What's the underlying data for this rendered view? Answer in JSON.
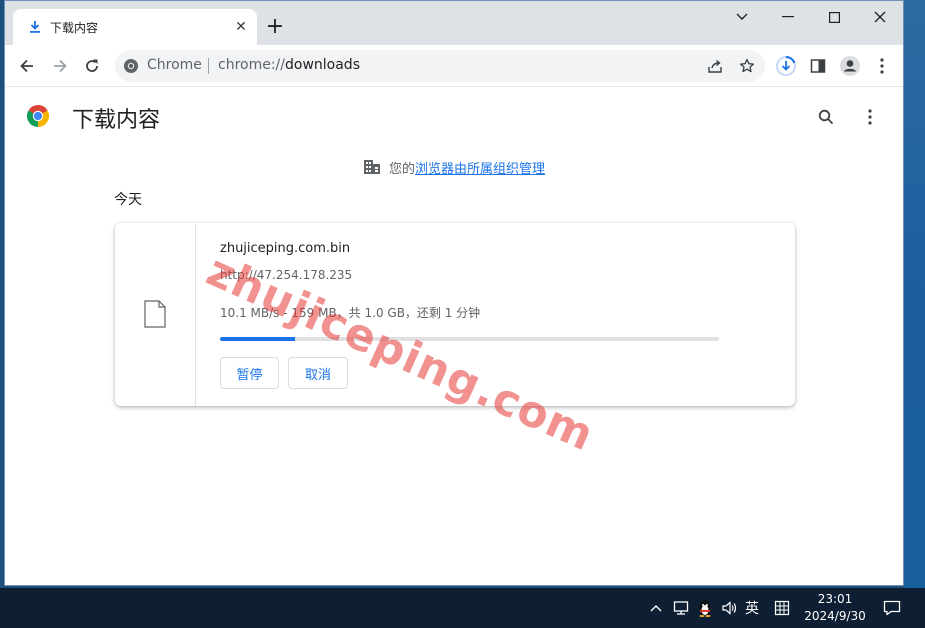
{
  "browser": {
    "tab": {
      "title": "下载内容",
      "icon": "download-icon"
    },
    "omnibox": {
      "chip": "Chrome",
      "url_scheme": "chrome://",
      "url_path": "downloads"
    },
    "accent_color": "#1a73e8"
  },
  "page": {
    "title": "下载内容",
    "managed": {
      "prefix": "您的",
      "link": "浏览器由所属组织管理"
    },
    "section_date": "今天",
    "download": {
      "file_name": "zhujiceping.com.bin",
      "source_url": "http://47.254.178.235",
      "status": "10.1 MB/s - 159 MB，共 1.0 GB，还剩 1 分钟",
      "progress_fraction": 0.15,
      "pause_label": "暂停",
      "cancel_label": "取消"
    },
    "watermark": "zhujiceping.com"
  },
  "taskbar": {
    "ime_label": "英",
    "time": "23:01",
    "date": "2024/9/30"
  }
}
